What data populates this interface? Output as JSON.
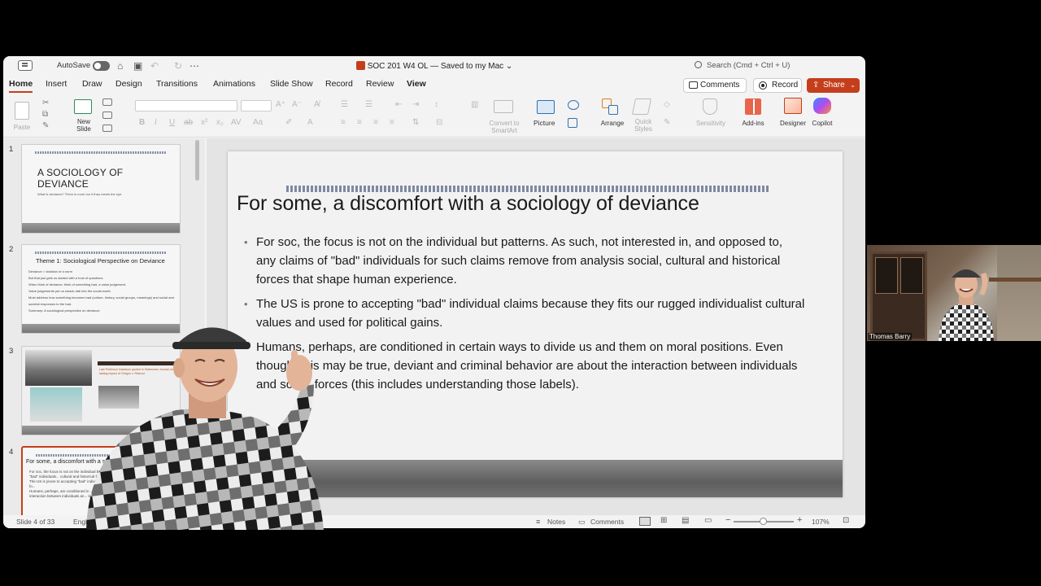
{
  "titlebar": {
    "autosave_label": "AutoSave",
    "doc_title": "SOC 201 W4 OL — Saved to my Mac ⌄",
    "search_placeholder": "Search (Cmd + Ctrl + U)"
  },
  "tabs": [
    "Home",
    "Insert",
    "Draw",
    "Design",
    "Transitions",
    "Animations",
    "Slide Show",
    "Record",
    "Review",
    "View"
  ],
  "actions": {
    "comments": "Comments",
    "record": "Record",
    "share": "Share"
  },
  "ribbon": {
    "paste": "Paste",
    "new_slide_1": "New",
    "new_slide_2": "Slide",
    "convert_1": "Convert to",
    "convert_2": "SmartArt",
    "picture": "Picture",
    "arrange": "Arrange",
    "quick_1": "Quick",
    "quick_2": "Styles",
    "sensitivity": "Sensitivity",
    "addins": "Add-ins",
    "designer": "Designer",
    "copilot": "Copilot"
  },
  "thumbnails": {
    "numbers": [
      "1",
      "2",
      "3",
      "4"
    ],
    "t1_title_1": "A SOCIOLOGY OF",
    "t1_title_2": "DEVIANCE",
    "t1_sub": "What is deviance? There is more too it than meets the eye.",
    "t2_title": "Theme 1: Sociological Perspective on Deviance",
    "t2_items": [
      "Deviance = violation of a norm",
      "But that just gets us started with a host of questions.",
      "When think of deviance, think of something bad, a value judgement.",
      "Value judgements put us smack dab into the social world.",
      "Must address how something becomes bad (culture, history, social groups, meanings) and social and societal responses to the bad.",
      "Summary: A sociological perspective on deviance"
    ],
    "t3_caption": "Law Professor Davidson quoted in Statesman Journal on lasting impact of Oregon v. Rideout",
    "t4_title": "For some, a discomfort with a sociology of deviance",
    "t4_items": [
      "For soc, the focus is not on the individual but patterns... opposed to, any claims of \"bad\" individuals... cultural and historical forces that shape h...",
      "The US is prone to accepting \"bad\" individ... individualist cultural values and used fo...",
      "Humans, perhaps, are conditioned in ... positions. Even thought this may be ... interaction between individuals an... labeling)."
    ]
  },
  "slide": {
    "title": "For some, a discomfort with a sociology of deviance",
    "bullets": [
      "For soc, the focus is not on the individual but patterns.  As such, not interested in, and opposed to, any claims of \"bad\" individuals for such claims remove from analysis social, cultural and historical forces that shape human experience.",
      "The US is prone to accepting \"bad\" individual claims because they fits our rugged individualist cultural values and used for political gains.",
      "Humans, perhaps, are conditioned in certain ways to divide us and them on moral positions.  Even thought this may be true, deviant and criminal behavior are about the interaction between individuals and social forces (this includes understanding those labels)."
    ]
  },
  "status": {
    "slide_count": "Slide 4 of 33",
    "language": "English",
    "notes": "Notes",
    "comments": "Comments",
    "zoom": "107%"
  },
  "webcam": {
    "name": "Thomas Barry"
  },
  "colors": {
    "accent": "#c43e1c",
    "slide_bg": "#f2f2f2",
    "ribbon_bg": "#f3f3f3"
  }
}
